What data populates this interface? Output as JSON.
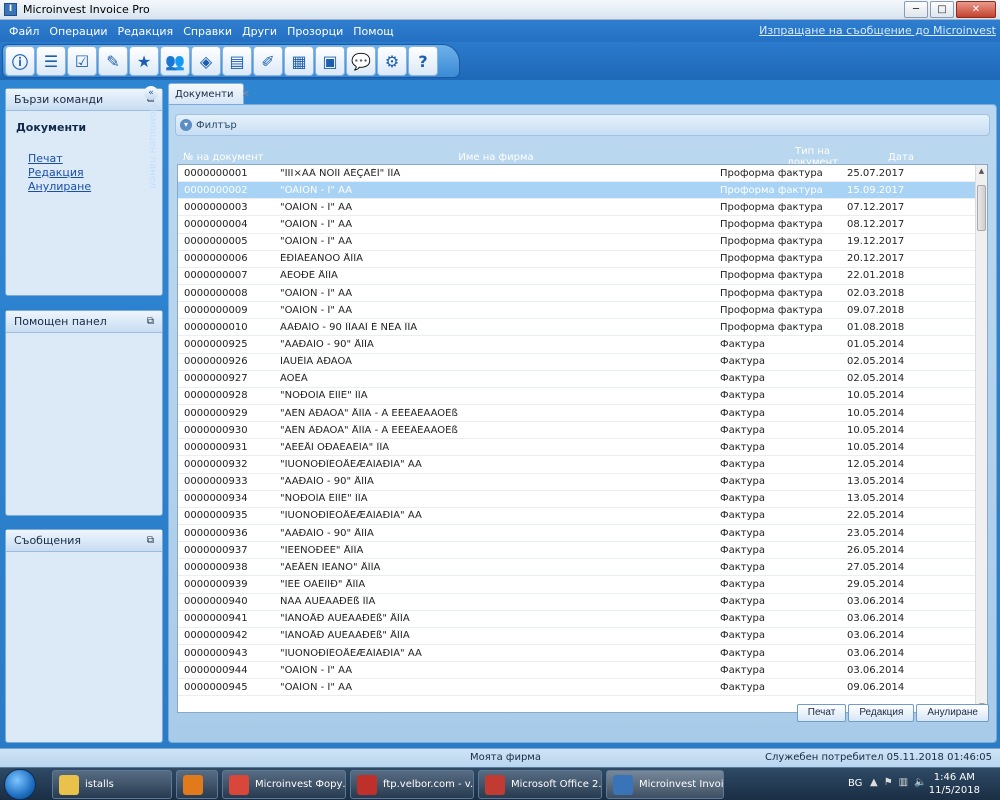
{
  "window": {
    "title": "Microinvest Invoice Pro",
    "minimize": "─",
    "maximize": "□",
    "close": "✕"
  },
  "menu": {
    "items": [
      "Файл",
      "Операции",
      "Редакция",
      "Справки",
      "Други",
      "Прозорци",
      "Помощ"
    ],
    "link": "Изпращане на съобщение до Microinvest"
  },
  "toolbar": {
    "icons": [
      "info-icon",
      "document-list-icon",
      "checkbox-icon",
      "edit-icon",
      "star-icon",
      "users-icon",
      "cube-icon",
      "book-icon",
      "notepad-icon",
      "user-card-icon",
      "box-icon",
      "chat-bubble-icon",
      "gears-icon",
      "help-icon"
    ],
    "glyphs": [
      "ⓘ",
      "☰",
      "☑",
      "✎",
      "★",
      "👥",
      "◈",
      "▤",
      "✐",
      "▦",
      "▣",
      "💬",
      "⚙",
      "?"
    ]
  },
  "sidebar": {
    "quick_commands": {
      "header": "Бързи команди",
      "section_title": "Документи",
      "links": [
        "Печат",
        "Редакция",
        "Анулиране"
      ]
    },
    "help_panel": {
      "header": "Помощен панел"
    },
    "messages": {
      "header": "Съобщения"
    },
    "vertical_label": "Помощен панел",
    "pin_glyph": "⧉",
    "collapse_glyph": "«"
  },
  "documents": {
    "tab_label": "Документи",
    "tab_close": "✕",
    "filter_label": "Филтър",
    "columns": [
      "№ на документ",
      "Име на фирма",
      "Тип на документ",
      "Дата"
    ],
    "rows": [
      [
        "0000000001",
        "\"ÏÏÏ×ÀÂ ÑÒÎÏ ÂÈÇÀÉÍ\" ÎÎÄ",
        "Проформа фактура",
        "25.07.2017"
      ],
      [
        "0000000002",
        "\"ÕÀÍÓÑ - Î\" ÀÄ",
        "Проформа фактура",
        "15.09.2017"
      ],
      [
        "0000000003",
        "\"ÕÀÍÓÑ - Î\" ÀÄ",
        "Проформа фактура",
        "07.12.2017"
      ],
      [
        "0000000004",
        "\"ÕÀÍÓÑ - Î\" ÀÄ",
        "Проформа фактура",
        "08.12.2017"
      ],
      [
        "0000000005",
        "\"ÕÀÍÓÑ - Î\" ÀÄ",
        "Проформа фактура",
        "19.12.2017"
      ],
      [
        "0000000006",
        "ÈÐÍÁÈÀÑÒÒ ÅÎÎÄ",
        "Проформа фактура",
        "20.12.2017"
      ],
      [
        "0000000007",
        "ÂÈÕÐÈ ÅÎÎÄ",
        "Проформа фактура",
        "22.01.2018"
      ],
      [
        "0000000008",
        "\"ÕÀÍÓÑ - Î\" ÀÄ",
        "Проформа фактура",
        "02.03.2018"
      ],
      [
        "0000000009",
        "\"ÕÀÍÓÑ - Î\" ÀÄ",
        "Проформа фактура",
        "09.07.2018"
      ],
      [
        "0000000010",
        "ÂÀÐÀÍÒ - 90 ÎÎÄÀÎ È ÑÈÀ ÎÎÄ",
        "Проформа фактура",
        "01.08.2018"
      ],
      [
        "0000000925",
        "\"ÃÀÐÀÍÒ - 90\" ÅÎÎÄ",
        "Фактура",
        "01.05.2014"
      ],
      [
        "0000000926",
        "ÍÀÙÈÍÀ ÂÐÀÒÀ",
        "Фактура",
        "02.05.2014"
      ],
      [
        "0000000927",
        "ÁÓÊÀ",
        "Фактура",
        "02.05.2014"
      ],
      [
        "0000000928",
        "\"ÑÒÐÓÍÀ ÊÎÌÈ\" ÎÎÄ",
        "Фактура",
        "10.05.2014"
      ],
      [
        "0000000929",
        "\"ÁÈÑ ÂÐÀÒÀ\" ÅÎÎÄ - Â ËÈÊÂÈÄÀÖÈß",
        "Фактура",
        "10.05.2014"
      ],
      [
        "0000000930",
        "\"ÁÈÑ ÂÐÀÒÀ\" ÅÎÎÄ - Â ËÈÊÂÈÄÀÖÈß",
        "Фактура",
        "10.05.2014"
      ],
      [
        "0000000931",
        "\"ÀËÈÅÍ ÒÐÀÉÄÈÍÃ\" ÎÎÄ",
        "Фактура",
        "10.05.2014"
      ],
      [
        "0000000932",
        "\"ÏÚÒÑÒÐÎÈÒÅËÆÀÍÀÐÍÃ\" ÀÄ",
        "Фактура",
        "12.05.2014"
      ],
      [
        "0000000933",
        "\"ÃÀÐÀÍÒ - 90\" ÅÎÎÄ",
        "Фактура",
        "13.05.2014"
      ],
      [
        "0000000934",
        "\"ÑÒÐÓÍÀ ÊÎÌÈ\" ÎÎÄ",
        "Фактура",
        "13.05.2014"
      ],
      [
        "0000000935",
        "\"ÏÚÒÑÒÐÎÈÒÅËÆÀÍÀÐÍÃ\" ÀÄ",
        "Фактура",
        "22.05.2014"
      ],
      [
        "0000000936",
        "\"ÃÀÐÀÍÒ - 90\" ÅÎÎÄ",
        "Фактура",
        "23.05.2014"
      ],
      [
        "0000000937",
        "\"ÏËÊÑÒÐÈÉ\" ÅÎÎÄ",
        "Фактура",
        "26.05.2014"
      ],
      [
        "0000000938",
        "\"ÀËÅÊÑ ÏËÀÑÒ\" ÅÎÎÄ",
        "Фактура",
        "27.05.2014"
      ],
      [
        "0000000939",
        "\"ÏËÈ ÓÀÊÎÍÐ\" ÅÎÎÄ",
        "Фактура",
        "29.05.2014"
      ],
      [
        "0000000940",
        "ÑÀÄ ÀÚÈÃÀÐÈß ÎÎÄ",
        "Фактура",
        "03.06.2014"
      ],
      [
        "0000000941",
        "\"ÌÀÑÒÅÐ ÀÚÈÃÀÐÈß\" ÅÎÎÄ",
        "Фактура",
        "03.06.2014"
      ],
      [
        "0000000942",
        "\"ÌÀÑÒÅÐ ÀÚÈÃÀÐÈß\" ÅÎÎÄ",
        "Фактура",
        "03.06.2014"
      ],
      [
        "0000000943",
        "\"ÏÚÒÑÒÐÎÈÒÅËÆÀÍÀÐÍÃ\" ÀÄ",
        "Фактура",
        "03.06.2014"
      ],
      [
        "0000000944",
        "\"ÕÀÍÓÑ - Î\" ÀÄ",
        "Фактура",
        "03.06.2014"
      ],
      [
        "0000000945",
        "\"ÕÀÍÓÑ - Î\" ÀÄ",
        "Фактура",
        "09.06.2014"
      ]
    ],
    "selected_row": 1,
    "buttons": {
      "print": "Печат",
      "edit": "Редакция",
      "cancel": "Анулиране"
    }
  },
  "status": {
    "company": "Моята фирма",
    "user": "Служебен потребител   05.11.2018 01:46:05"
  },
  "taskbar": {
    "items": [
      {
        "label": "istalls",
        "icon": "folder-icon",
        "color": "#e8c24a"
      },
      {
        "label": "",
        "icon": "media-player-icon",
        "color": "#e07a1a"
      },
      {
        "label": "Microinvest Фору...",
        "icon": "chrome-icon",
        "color": "#d9463a"
      },
      {
        "label": "ftp.velbor.com - v...",
        "icon": "filezilla-icon",
        "color": "#c0302a"
      },
      {
        "label": "Microsoft Office 2...",
        "icon": "office-icon",
        "color": "#c23b32"
      },
      {
        "label": "Microinvest Invoi...",
        "icon": "invoice-app-icon",
        "color": "#3a74b8"
      }
    ],
    "lang": "BG",
    "time": "1:46 AM",
    "date": "11/5/2018"
  },
  "colors": {
    "accent": "#2b7cc7",
    "selected_row": "#a8d3f4"
  }
}
